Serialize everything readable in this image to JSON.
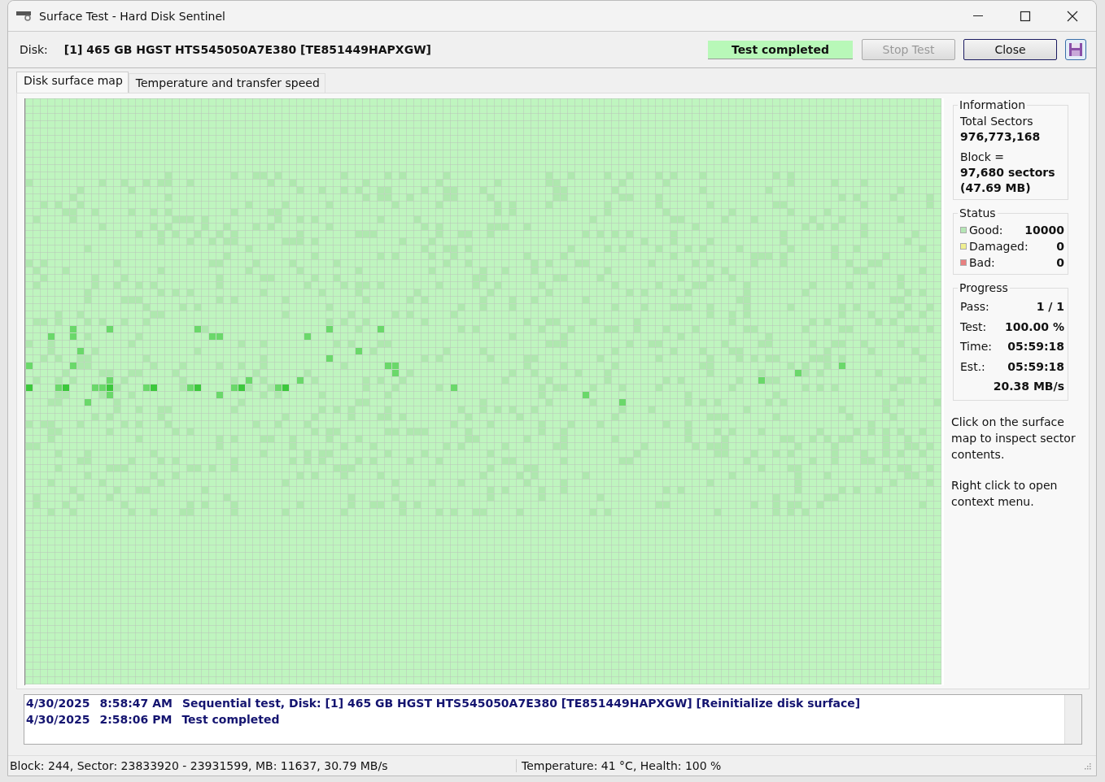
{
  "window": {
    "title": "Surface Test - Hard Disk Sentinel"
  },
  "toolbar": {
    "disk_label": "Disk:",
    "disk_value": "[1] 465 GB  HGST HTS545050A7E380 [TE851449HAPXGW]",
    "status": "Test completed",
    "buttons": [
      {
        "label": "Stop Test",
        "disabled": true,
        "kind": "text"
      },
      {
        "label": "Close",
        "disabled": false,
        "kind": "text"
      },
      {
        "kind": "save"
      }
    ]
  },
  "tabs": [
    {
      "label": "Disk surface map",
      "selected": true
    },
    {
      "label": "Temperature and transfer speed",
      "selected": false
    }
  ],
  "information": {
    "title": "Information",
    "lines": [
      {
        "text": "Total Sectors",
        "bold": false
      },
      {
        "text": "976,773,168",
        "bold": true
      },
      {
        "text": "Block =",
        "bold": false
      },
      {
        "text": "97,680 sectors",
        "bold": true
      },
      {
        "text": "(47.69 MB)",
        "bold": true
      }
    ]
  },
  "status": {
    "title": "Status",
    "items": [
      {
        "label": "Good:",
        "value": "10000",
        "color": "#b5e6b5"
      },
      {
        "label": "Damaged:",
        "value": "0",
        "color": "#f0f090"
      },
      {
        "label": "Bad:",
        "value": "0",
        "color": "#e88080"
      }
    ]
  },
  "progress": {
    "title": "Progress",
    "rows": [
      {
        "label": "Pass:",
        "value": "1 / 1"
      },
      {
        "label": "Test:",
        "value": "100.00 %"
      },
      {
        "label": "Time:",
        "value": "05:59:18"
      },
      {
        "label": "Est.:",
        "value": "05:59:18"
      },
      {
        "value": "20.38 MB/s"
      }
    ]
  },
  "hints": [
    "Click on the surface map to inspect sector contents.",
    "Right click to open context menu."
  ],
  "log": [
    {
      "date": "4/30/2025",
      "time": "8:58:47 AM",
      "message": "Sequential test, Disk: [1] 465 GB  HGST HTS545050A7E380 [TE851449HAPXGW] [Reinitialize disk surface]"
    },
    {
      "date": "4/30/2025",
      "time": "2:58:06 PM",
      "message": "Test completed"
    }
  ],
  "status_bar": [
    "Block: 244, Sector: 23833920 - 23931599, MB: 11637, 30.79 MB/s",
    "Temperature: 41  °C,  Health: 100 %"
  ]
}
